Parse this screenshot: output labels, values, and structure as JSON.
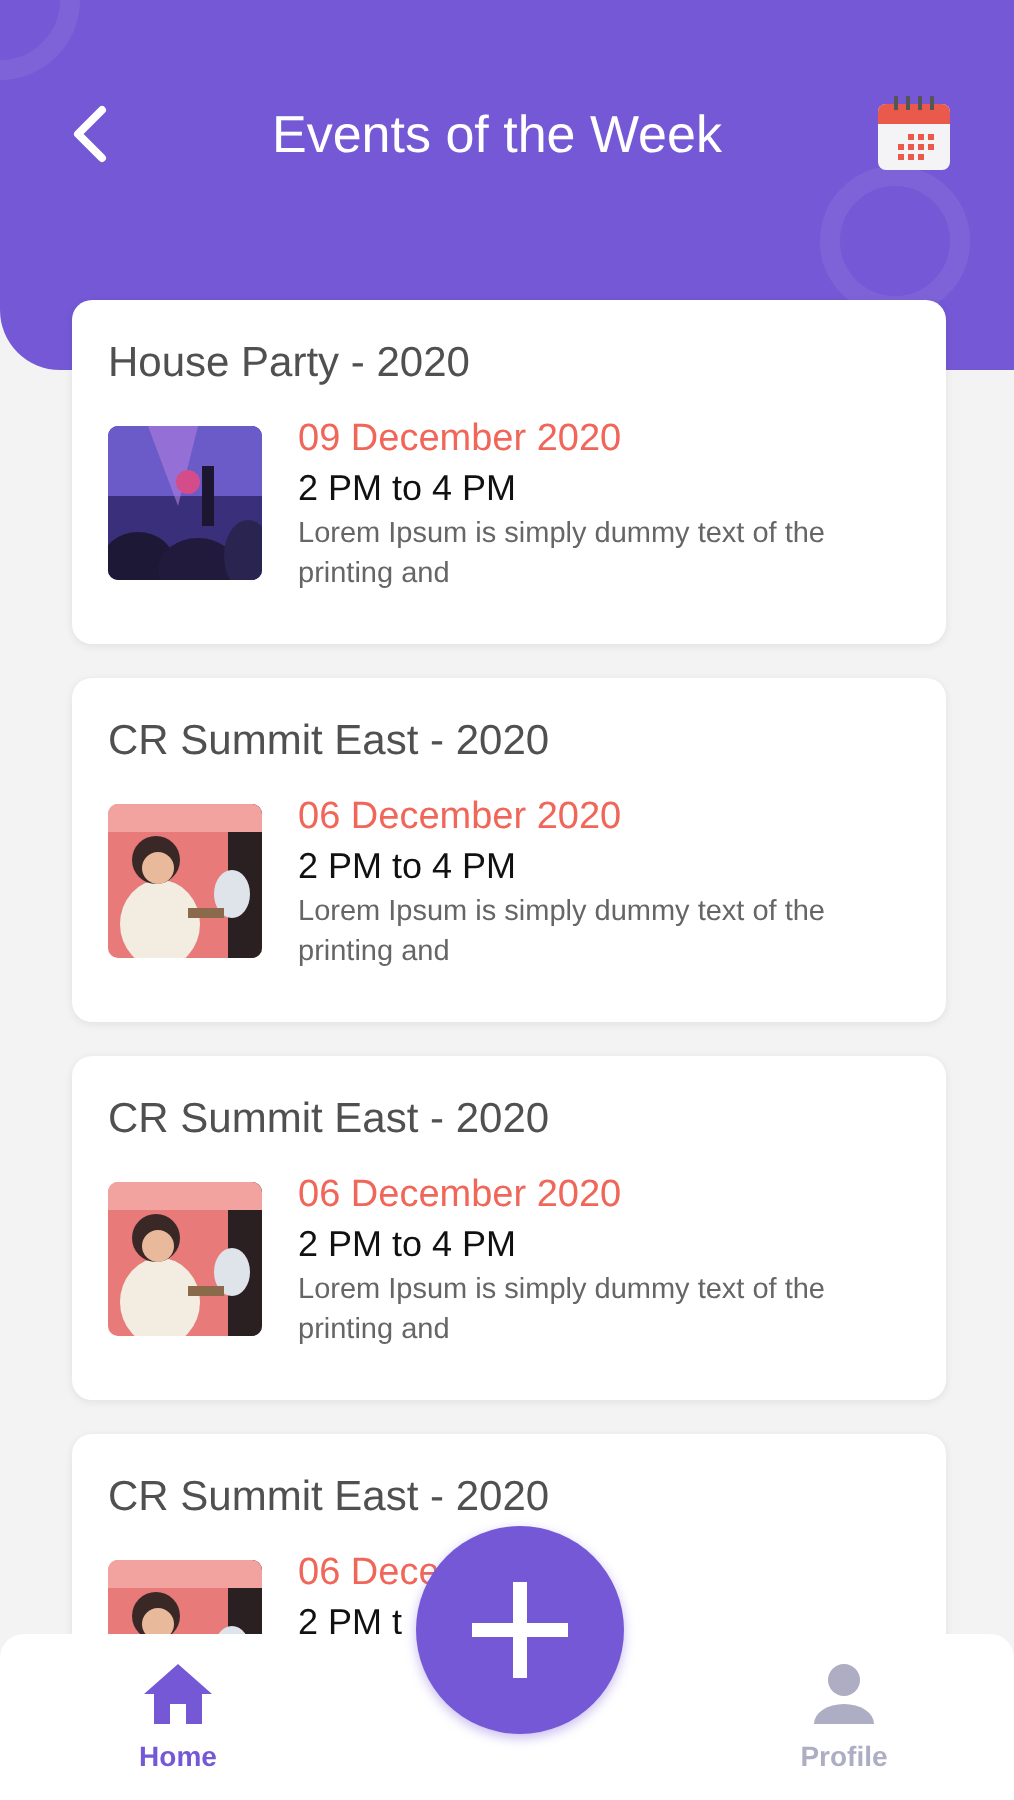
{
  "header": {
    "title": "Events of the Week"
  },
  "events": [
    {
      "title": "House Party - 2020",
      "date": "09 December 2020",
      "time": "2 PM to 4 PM",
      "description": "Lorem Ipsum is simply dummy text of the printing and"
    },
    {
      "title": "CR Summit East - 2020",
      "date": "06 December 2020",
      "time": "2 PM to 4 PM",
      "description": "Lorem Ipsum is simply dummy text of the printing and"
    },
    {
      "title": "CR Summit East - 2020",
      "date": "06 December 2020",
      "time": "2 PM to 4 PM",
      "description": "Lorem Ipsum is simply dummy text of the printing and"
    },
    {
      "title": "CR Summit East - 2020",
      "date": "06 Dece",
      "time": "2 PM t"
    }
  ],
  "nav": [
    {
      "label": "Home",
      "kind": "home",
      "selected": true
    },
    {
      "label": "Profile",
      "kind": "profile",
      "selected": false
    }
  ]
}
